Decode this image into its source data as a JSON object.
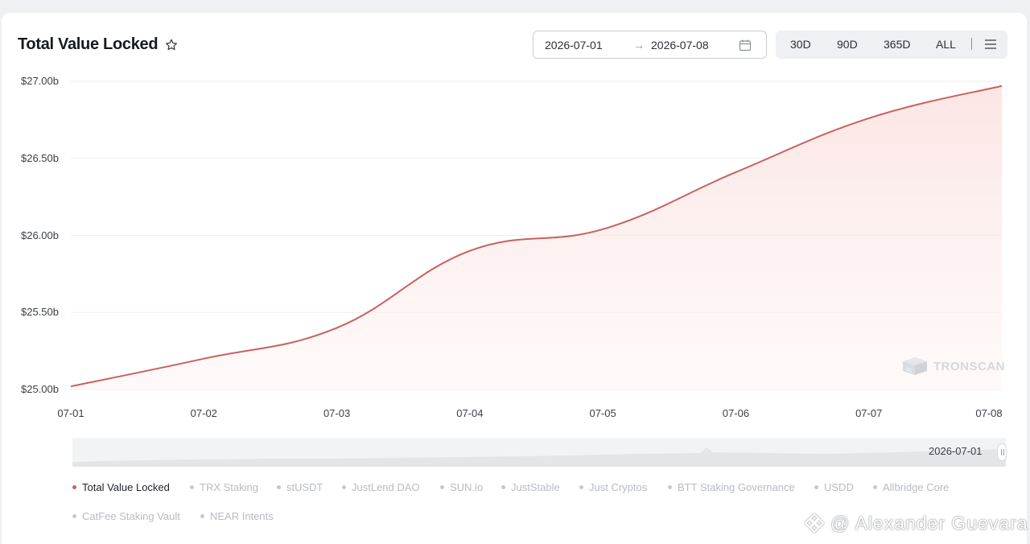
{
  "header": {
    "title": "Total Value Locked",
    "favorite_icon": "star-outline-icon"
  },
  "date_range": {
    "start": "2026-07-01",
    "arrow": "→",
    "end": "2026-07-08",
    "icon": "calendar-icon"
  },
  "range_buttons": [
    "30D",
    "90D",
    "365D",
    "ALL"
  ],
  "menu_icon": "hamburger-menu-icon",
  "watermark": {
    "brand": "TRONSCAN",
    "credit": "@ Alexander Guevara"
  },
  "zoom": {
    "label": "2026-07-01"
  },
  "legend": [
    {
      "label": "Total Value Locked",
      "active": true
    },
    {
      "label": "TRX Staking",
      "active": false
    },
    {
      "label": "stUSDT",
      "active": false
    },
    {
      "label": "JustLend DAO",
      "active": false
    },
    {
      "label": "SUN.io",
      "active": false
    },
    {
      "label": "JustStable",
      "active": false
    },
    {
      "label": "Just Cryptos",
      "active": false
    },
    {
      "label": "BTT Staking Governance",
      "active": false
    },
    {
      "label": "USDD",
      "active": false
    },
    {
      "label": "Allbridge Core",
      "active": false
    },
    {
      "label": "CatFee Staking Vault",
      "active": false
    },
    {
      "label": "NEAR Intents",
      "active": false
    }
  ],
  "colors": {
    "line": "#c9615f",
    "area_top": "#fbe7e5",
    "grid": "#eceef1"
  },
  "chart_data": {
    "type": "area",
    "title": "Total Value Locked",
    "x": [
      "07-01",
      "07-02",
      "07-03",
      "07-04",
      "07-05",
      "07-06",
      "07-07",
      "07-08"
    ],
    "series": [
      {
        "name": "Total Value Locked",
        "values": [
          25.02,
          25.2,
          25.4,
          25.9,
          26.04,
          26.41,
          26.76,
          26.97
        ]
      }
    ],
    "y_ticks": [
      "$25.00b",
      "$25.50b",
      "$26.00b",
      "$26.50b",
      "$27.00b"
    ],
    "ylim": [
      25.0,
      27.0
    ],
    "unit": "USD billions",
    "grid": true
  }
}
